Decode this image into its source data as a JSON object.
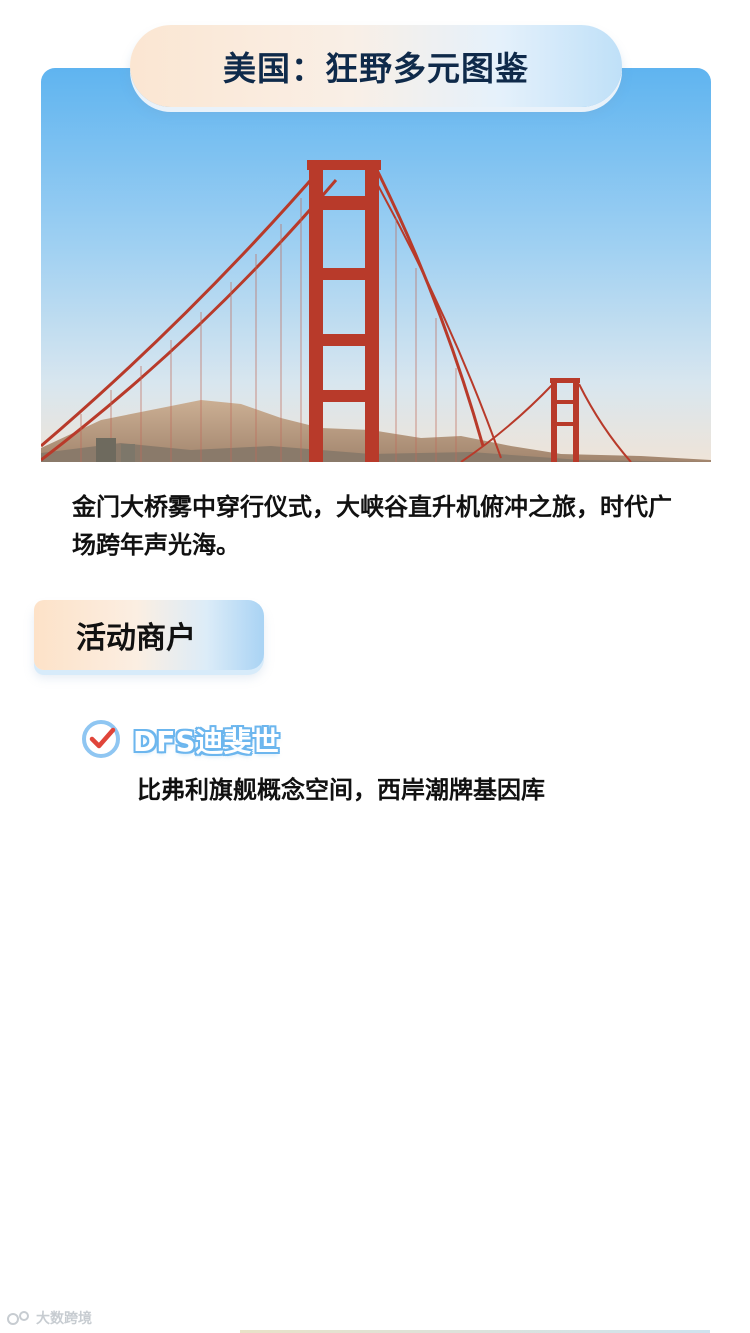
{
  "header": {
    "title": "美国：狂野多元图鉴"
  },
  "hero": {
    "image": "golden-gate-bridge",
    "sky_top_color": "#5fb4f0",
    "sky_bottom_color": "#e8ecf0",
    "bridge_color": "#b83a2a"
  },
  "intro": {
    "description": "金门大桥雾中穿行仪式，大峡谷直升机俯冲之旅，时代广场跨年声光海。"
  },
  "section": {
    "title": "活动商户"
  },
  "merchants": [
    {
      "icon": "check-circle-icon",
      "name": "DFS迪斐世",
      "description": "比弗利旗舰概念空间，西岸潮牌基因库"
    }
  ],
  "watermark": {
    "text": "大数跨境",
    "icon": "logo-icon"
  },
  "colors": {
    "accent_blue": "#6cb6ee",
    "check_red": "#e0453a",
    "title_navy": "#0f2a4a"
  }
}
